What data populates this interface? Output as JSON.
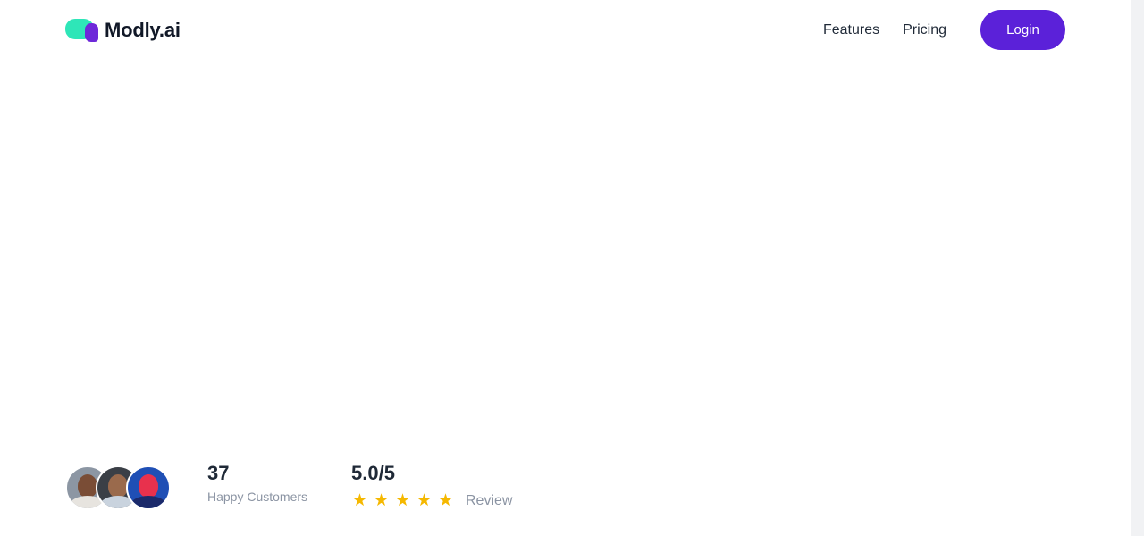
{
  "brand": {
    "name": "Modly.ai",
    "teal": "#2ee6b8",
    "purple": "#6d28d9"
  },
  "nav": {
    "features": "Features",
    "pricing": "Pricing",
    "login": "Login",
    "login_color": "#5b21d9"
  },
  "stats": {
    "avatars": [
      "avatar-1",
      "avatar-2",
      "avatar-3"
    ],
    "customers_count": "37",
    "customers_label": "Happy Customers",
    "rating": "5.0/5",
    "stars": 5,
    "star_color": "#f5b800",
    "review_label": "Review"
  }
}
